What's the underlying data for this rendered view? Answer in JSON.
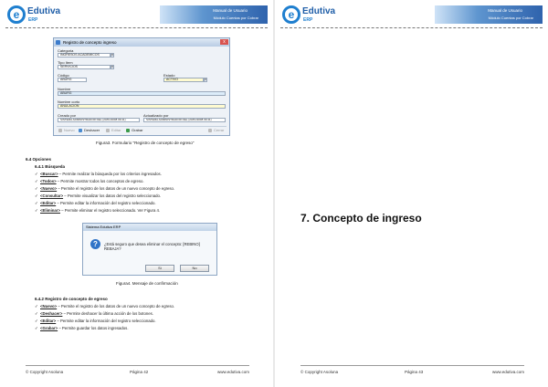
{
  "header": {
    "logo_name": "Edutiva",
    "logo_sub": "ERP",
    "banner_line1": "Manual de Usuario",
    "banner_line2": "Módulo Cuentas por Cobrar"
  },
  "left_page": {
    "dialog": {
      "title": "Registro de concepto ingreso",
      "close": "x",
      "categoria_label": "Categoria",
      "categoria_value": "INGRESOS ACADEMICOS",
      "tipo_label": "Tipo Item",
      "tipo_value": "SERVICIOS",
      "codigo_label": "Código",
      "codigo_value": "ABURG",
      "estado_label": "Estado",
      "estado_value": "ACTIVO",
      "nombre_label": "Nombre",
      "nombre_value": "ABURG",
      "nombre_corto_label": "Nombre corto",
      "nombre_corto_value": "ANULACION",
      "creado_label": "Creado por",
      "creado_value": "SISTEMA ADMINISTRADOR DEL (23/01/2008 09:41)",
      "actualizado_label": "Actualizado por",
      "actualizado_value": "SISTEMA ADMINISTRADOR DEL (23/01/2008 09:41)",
      "toolbar": {
        "nuevo": "Nuevo",
        "deshacer": "Deshacer",
        "editar": "Editar",
        "grabar": "Grabar",
        "cerrar": "Cerrar"
      }
    },
    "caption1": "Figura3. Formulario \"Registro de concepto de egreso\"",
    "section_title": "6.4 Opciones",
    "subsection1": "6.4.1 Búsqueda",
    "items1": [
      {
        "cmd": "<Buscar>",
        "text": " – Permite realizar la búsqueda por los criterios ingresados."
      },
      {
        "cmd": "<Todos>",
        "text": " – Permite mostrar todos los conceptos de egreso."
      },
      {
        "cmd": "<Nuevo>",
        "text": " – Permite el registro de los datos de un nuevo concepto de egreso."
      },
      {
        "cmd": "<Consultar>",
        "text": " – Permite visualizar los datos del registro seleccionado."
      },
      {
        "cmd": "<Editar>",
        "text": " – Permite editar la información del registro seleccionado."
      },
      {
        "cmd": "<Eliminar>",
        "text": " – Permite eliminar el registro seleccionado. Ver Figura 4."
      }
    ],
    "confirm": {
      "title": "Sistema Edutiva ERP",
      "icon": "?",
      "message": "¿Está seguro que desea eliminar el concepto: [REBINO] REBAJA?",
      "yes": "Sí",
      "no": "No"
    },
    "caption2": "Figura4. Mensaje de confirmación",
    "subsection2": "6.4.2 Registro de concepto de egreso",
    "items2": [
      {
        "cmd": "<Nuevo>",
        "text": " – Permite el registro de los datos de un nuevo concepto de egreso."
      },
      {
        "cmd": "<Deshacer>",
        "text": " – Permite deshacer la última acción de los botones."
      },
      {
        "cmd": "<Editar>",
        "text": " – Permite editar la información del registro seleccionado."
      },
      {
        "cmd": "<Grabar>",
        "text": " – Permite guardar los datos ingresados."
      }
    ],
    "footer": {
      "left": "© Copyright Asoluna",
      "center": "Página 42",
      "right": "www.edutiva.com"
    }
  },
  "right_page": {
    "chapter_title": "7. Concepto de ingreso",
    "footer": {
      "left": "© Copyright Asoluna",
      "center": "Página 43",
      "right": "www.edutiva.com"
    }
  },
  "colors": {
    "accent": "#1f7fcf",
    "required_field": "#fffbd0",
    "selected_field": "#dcecf9"
  }
}
